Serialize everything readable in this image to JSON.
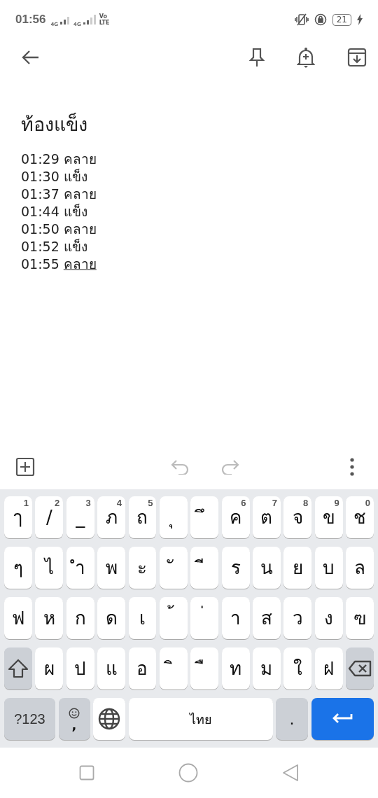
{
  "status_bar": {
    "time": "01:56",
    "network_1": "4G",
    "network_2": "4G",
    "volte": "Vo",
    "lte": "LTE",
    "battery": "21"
  },
  "note": {
    "title": "ท้องแข็ง",
    "lines": [
      {
        "time": "01:29",
        "text": "คลาย",
        "underlined": false
      },
      {
        "time": "01:30",
        "text": "แข็ง",
        "underlined": false
      },
      {
        "time": "01:37",
        "text": "คลาย",
        "underlined": false
      },
      {
        "time": "01:44",
        "text": "แข็ง",
        "underlined": false
      },
      {
        "time": "01:50",
        "text": "คลาย",
        "underlined": false
      },
      {
        "time": "01:52",
        "text": "แข็ง",
        "underlined": false
      },
      {
        "time": "01:55",
        "text": "คลาย",
        "underlined": true
      }
    ]
  },
  "editor_toolbar": {
    "undo_disabled": true,
    "redo_disabled": true
  },
  "keyboard": {
    "letter_rows": [
      {
        "keys": [
          {
            "kind": "char",
            "label": "ๅ",
            "hint": "1"
          },
          {
            "kind": "char",
            "label": "/",
            "hint": "2"
          },
          {
            "kind": "char",
            "label": "_",
            "hint": "3"
          },
          {
            "kind": "char",
            "label": "ภ",
            "hint": "4"
          },
          {
            "kind": "char",
            "label": "ถ",
            "hint": "5"
          },
          {
            "kind": "char",
            "label": "ุ"
          },
          {
            "kind": "char",
            "label": "ึ"
          },
          {
            "kind": "char",
            "label": "ค",
            "hint": "6"
          },
          {
            "kind": "char",
            "label": "ต",
            "hint": "7"
          },
          {
            "kind": "char",
            "label": "จ",
            "hint": "8"
          },
          {
            "kind": "char",
            "label": "ข",
            "hint": "9"
          },
          {
            "kind": "char",
            "label": "ช",
            "hint": "0"
          }
        ]
      },
      {
        "keys": [
          {
            "kind": "char",
            "label": "ๆ"
          },
          {
            "kind": "char",
            "label": "ไ"
          },
          {
            "kind": "char",
            "label": "ำ"
          },
          {
            "kind": "char",
            "label": "พ"
          },
          {
            "kind": "char",
            "label": "ะ"
          },
          {
            "kind": "char",
            "label": "ั"
          },
          {
            "kind": "char",
            "label": "ี"
          },
          {
            "kind": "char",
            "label": "ร"
          },
          {
            "kind": "char",
            "label": "น"
          },
          {
            "kind": "char",
            "label": "ย"
          },
          {
            "kind": "char",
            "label": "บ"
          },
          {
            "kind": "char",
            "label": "ล"
          }
        ]
      },
      {
        "keys": [
          {
            "kind": "char",
            "label": "ฟ"
          },
          {
            "kind": "char",
            "label": "ห"
          },
          {
            "kind": "char",
            "label": "ก"
          },
          {
            "kind": "char",
            "label": "ด"
          },
          {
            "kind": "char",
            "label": "เ"
          },
          {
            "kind": "char",
            "label": "้"
          },
          {
            "kind": "char",
            "label": "่"
          },
          {
            "kind": "char",
            "label": "า"
          },
          {
            "kind": "char",
            "label": "ส"
          },
          {
            "kind": "char",
            "label": "ว"
          },
          {
            "kind": "char",
            "label": "ง"
          },
          {
            "kind": "char",
            "label": "ฃ"
          }
        ]
      },
      {
        "keys": [
          {
            "kind": "shift"
          },
          {
            "kind": "char",
            "label": "ผ"
          },
          {
            "kind": "char",
            "label": "ป"
          },
          {
            "kind": "char",
            "label": "แ"
          },
          {
            "kind": "char",
            "label": "อ"
          },
          {
            "kind": "char",
            "label": "ิ"
          },
          {
            "kind": "char",
            "label": "ื"
          },
          {
            "kind": "char",
            "label": "ท"
          },
          {
            "kind": "char",
            "label": "ม"
          },
          {
            "kind": "char",
            "label": "ใ"
          },
          {
            "kind": "char",
            "label": "ฝ"
          },
          {
            "kind": "backspace"
          }
        ]
      }
    ],
    "bottom_row": {
      "keys": [
        {
          "kind": "symbols",
          "label": "?123"
        },
        {
          "kind": "emoji",
          "label": ","
        },
        {
          "kind": "globe"
        },
        {
          "kind": "space",
          "label": "ไทย"
        },
        {
          "kind": "period",
          "label": "."
        },
        {
          "kind": "enter"
        }
      ]
    }
  }
}
